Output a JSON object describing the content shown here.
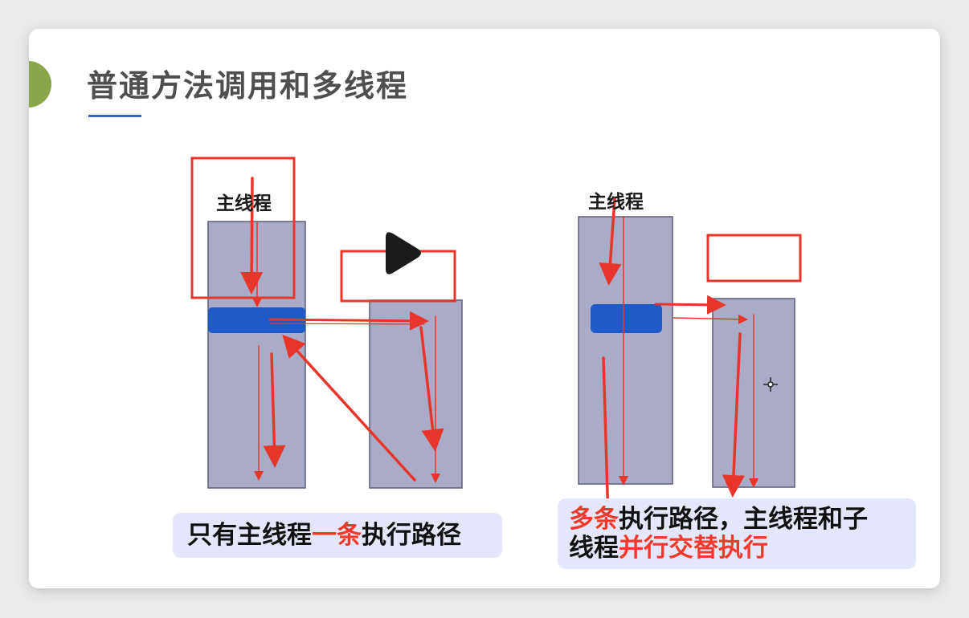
{
  "slide": {
    "title": "普通方法调用和多线程",
    "accent_color": "#8aa64a"
  },
  "diagram_left": {
    "main_thread_label": "主线程",
    "caption": {
      "part1": "只有主线程",
      "part2_highlight": "一条",
      "part3": "执行路径"
    }
  },
  "diagram_right": {
    "main_thread_label": "主线程",
    "caption": {
      "line1_highlight": "多条",
      "line1_rest": "执行路径，主线程和子",
      "line2_plain": "线程",
      "line2_highlight": "并行交替执行"
    }
  },
  "colors": {
    "thread_bar": "#a9abc7",
    "method_block": "#1e5bc6",
    "arrow": "#e8352c",
    "highlight_text": "#f23a2c",
    "caption_bg": "#e4e6fb"
  },
  "icons": [
    "play-icon",
    "crosshair-cursor-icon"
  ]
}
